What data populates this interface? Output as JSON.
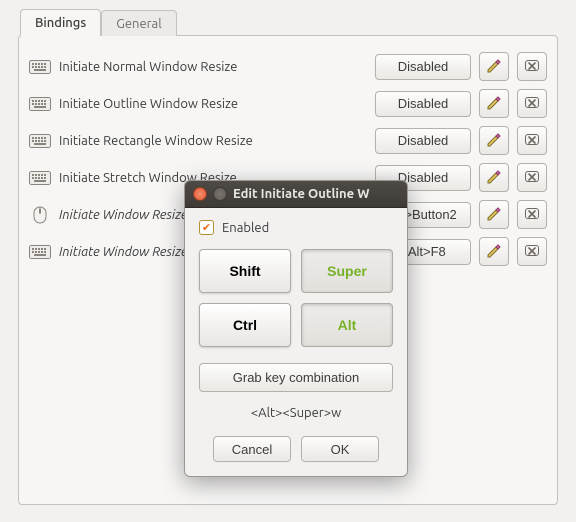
{
  "tabs": {
    "bindings": "Bindings",
    "general": "General"
  },
  "rows": [
    {
      "icon": "keyboard",
      "label": "Initiate Normal Window Resize",
      "italic": false,
      "binding": "Disabled"
    },
    {
      "icon": "keyboard",
      "label": "Initiate Outline Window Resize",
      "italic": false,
      "binding": "Disabled"
    },
    {
      "icon": "keyboard",
      "label": "Initiate Rectangle Window Resize",
      "italic": false,
      "binding": "Disabled"
    },
    {
      "icon": "keyboard",
      "label": "Initiate Stretch Window Resize",
      "italic": false,
      "binding": "Disabled"
    },
    {
      "icon": "mouse",
      "label": "Initiate Window Resize",
      "italic": true,
      "binding": "Alt>Button2"
    },
    {
      "icon": "keyboard",
      "label": "Initiate Window Resize",
      "italic": true,
      "binding": "<Alt>F8"
    }
  ],
  "dialog": {
    "title": "Edit Initiate Outline W",
    "enabled_label": "Enabled",
    "mods": {
      "shift": "Shift",
      "super": "Super",
      "ctrl": "Ctrl",
      "alt": "Alt"
    },
    "grab_label": "Grab key combination",
    "combo": "<Alt><Super>w",
    "cancel": "Cancel",
    "ok": "OK"
  }
}
